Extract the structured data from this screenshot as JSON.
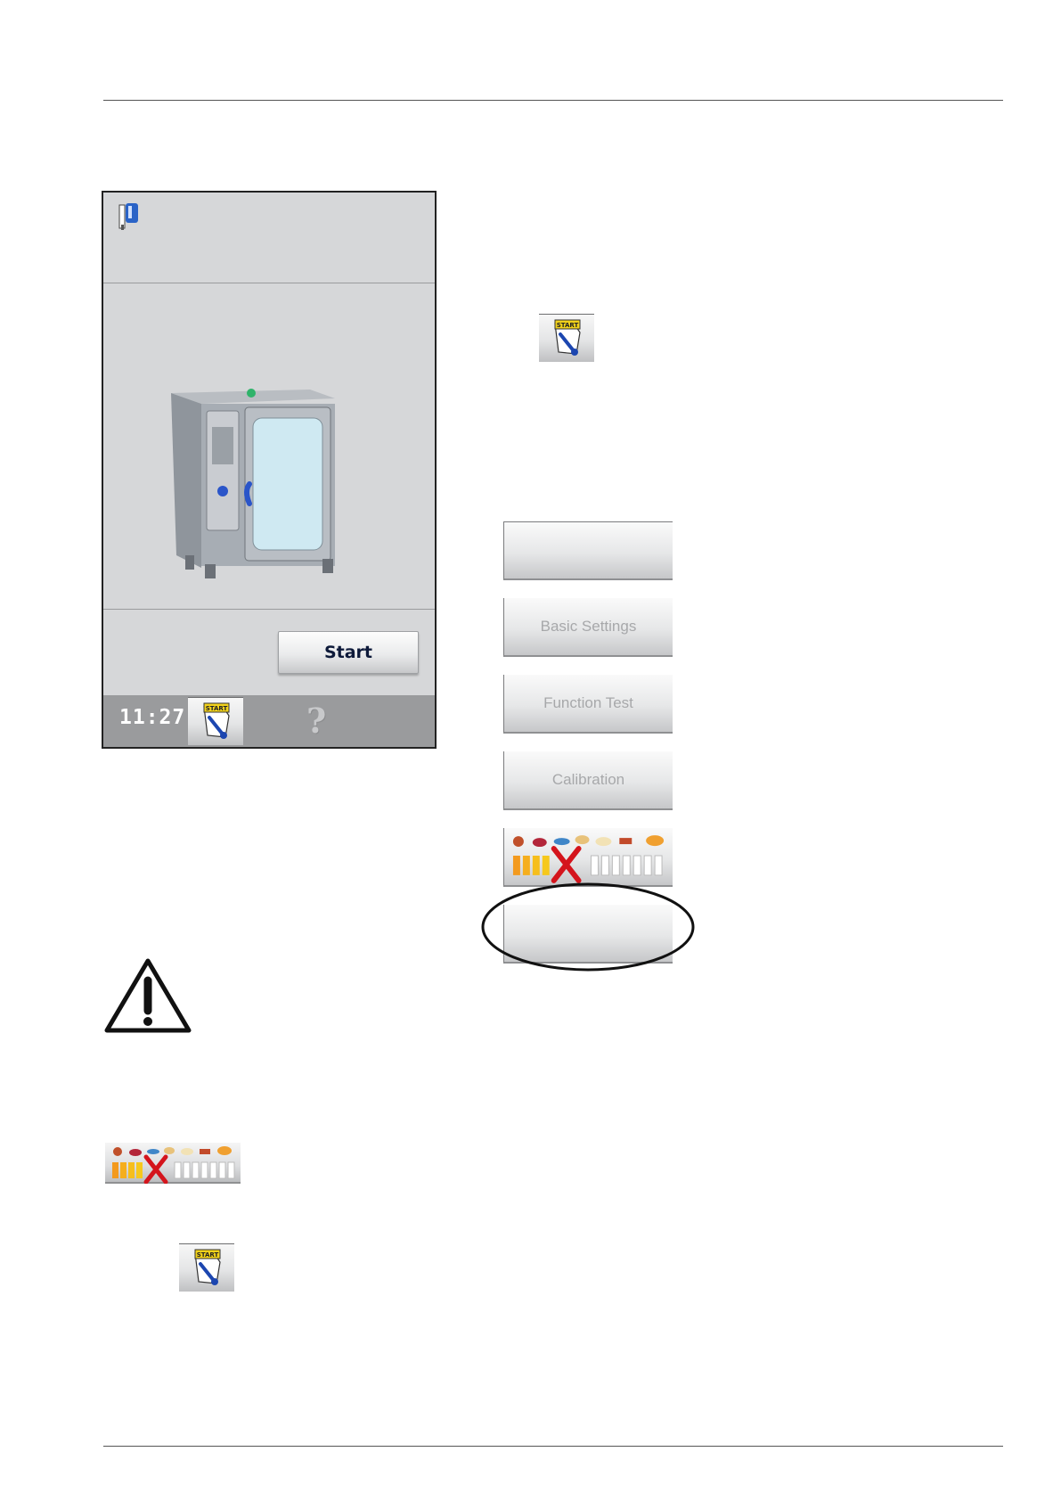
{
  "device": {
    "start_label": "Start",
    "clock": "11:27",
    "help_symbol": "?"
  },
  "menu": {
    "items": [
      {
        "label": ""
      },
      {
        "label": "Basic Settings"
      },
      {
        "label": "Function Test"
      },
      {
        "label": "Calibration"
      },
      {
        "label": ""
      },
      {
        "label": ""
      }
    ]
  },
  "icons": {
    "startcare_label": "START",
    "care_indicator": "care-level-indicator-icon",
    "warning": "warning-triangle-icon"
  },
  "colors": {
    "care_bar_orange": "#f39a1e",
    "care_bar_yellow": "#f6c81c",
    "care_x_red": "#d4141c"
  }
}
